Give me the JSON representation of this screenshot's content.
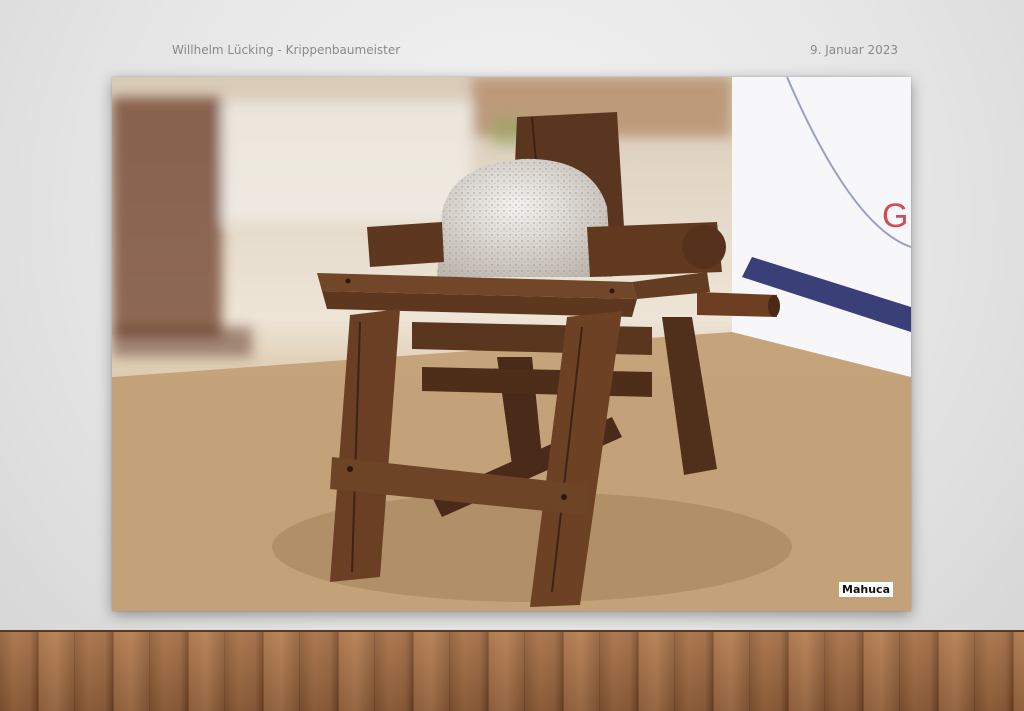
{
  "header": {
    "author": "Willhelm Lücking - Krippenbaumeister",
    "date": "9. Januar 2023"
  },
  "photo": {
    "watermark": "Mahuca",
    "sign_letter": "G",
    "colors": {
      "wood_dark": "#4a2a18",
      "wood_mid": "#6e4327",
      "stone": "#e4e0dc",
      "ground": "#c9a97f"
    }
  }
}
